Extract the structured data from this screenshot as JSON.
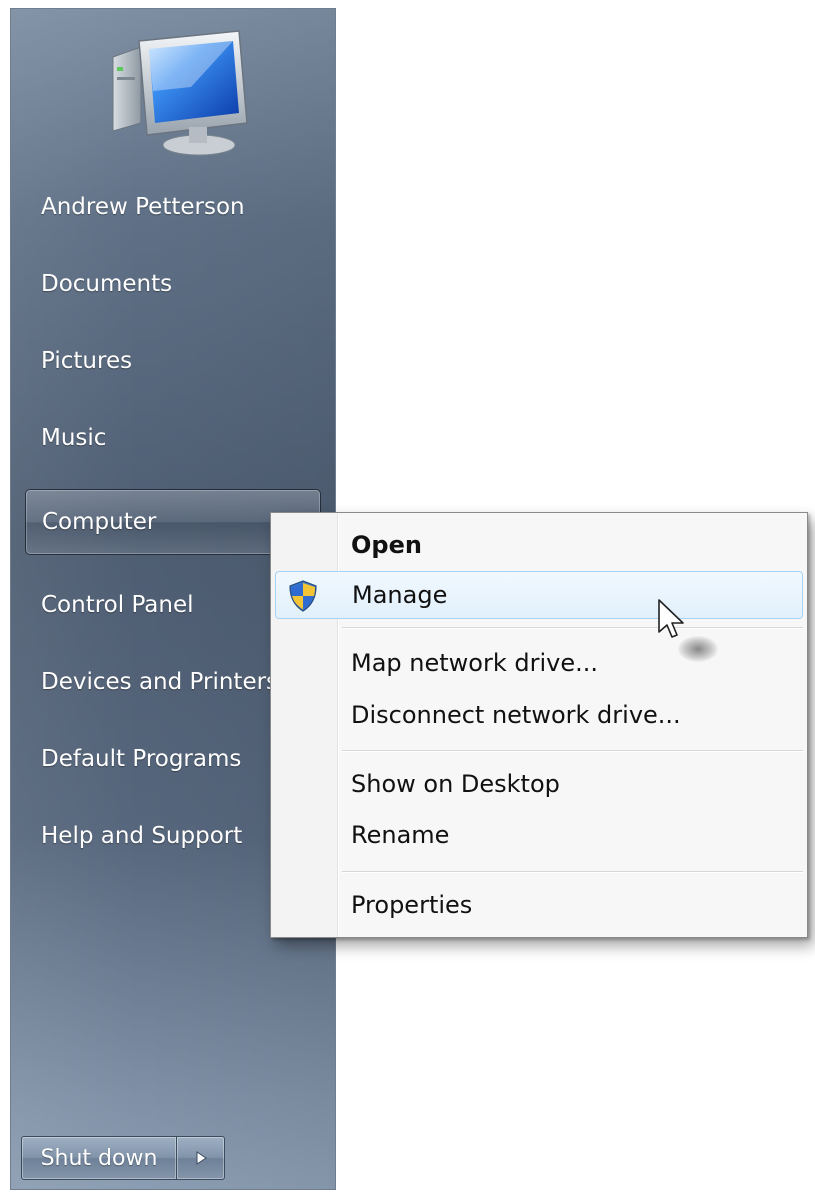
{
  "start_menu": {
    "items": [
      {
        "label": "Andrew Petterson"
      },
      {
        "label": "Documents"
      },
      {
        "label": "Pictures"
      },
      {
        "label": "Music"
      },
      {
        "label": "Computer"
      },
      {
        "label": "Control Panel"
      },
      {
        "label": "Devices and Printers"
      },
      {
        "label": "Default Programs"
      },
      {
        "label": "Help and Support"
      }
    ],
    "highlighted_item": "Computer",
    "shutdown_label": "Shut down",
    "user_picture_icon": "computer-monitor-icon",
    "shutdown_arrow_icon": "triangle-right-icon"
  },
  "context_menu": {
    "items": [
      {
        "label": "Open",
        "bold": true
      },
      {
        "label": "Manage",
        "icon": "uac-shield-icon",
        "hovered": true
      },
      {
        "label": "Map network drive..."
      },
      {
        "label": "Disconnect network drive..."
      },
      {
        "label": "Show on Desktop"
      },
      {
        "label": "Rename"
      },
      {
        "label": "Properties"
      }
    ]
  },
  "colors": {
    "pane_top": "#7d8ea3",
    "pane_mid": "#4e5d72",
    "menu_bg": "#f7f7f7",
    "hover_border": "#a8d3f3",
    "hover_bg": "#e1f0fc"
  }
}
